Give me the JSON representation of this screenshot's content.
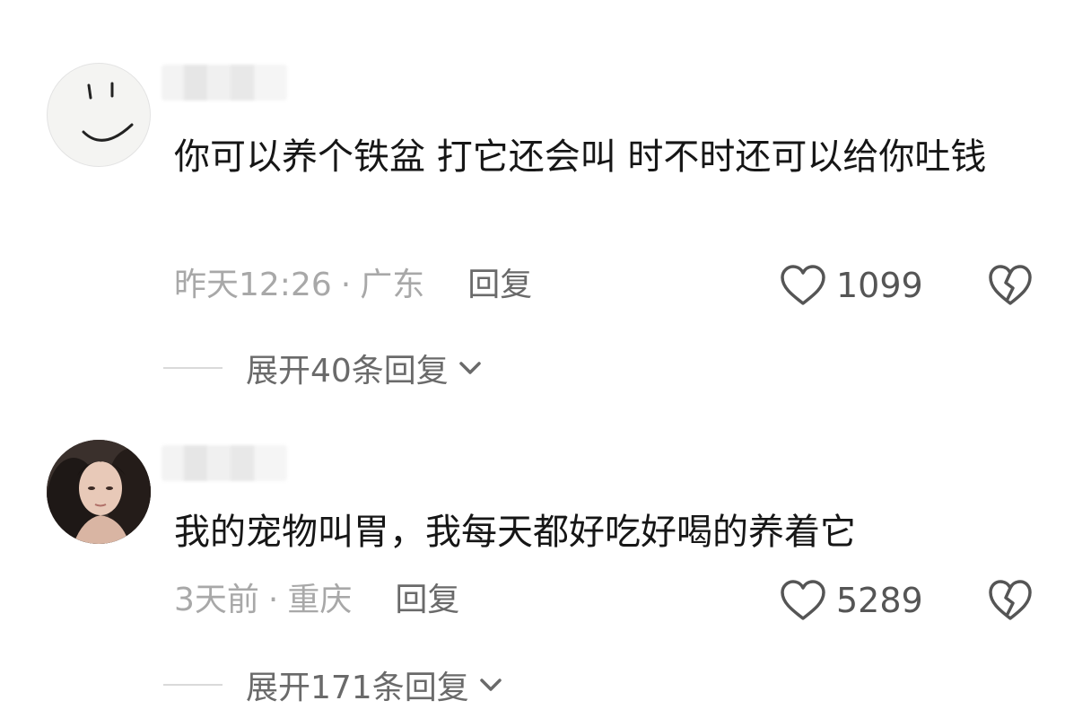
{
  "comments": [
    {
      "text": "你可以养个铁盆 打它还会叫 时不时还可以给你吐钱",
      "time": "昨天12:26",
      "location": "广东",
      "separator": "·",
      "reply_label": "回复",
      "like_count": "1099",
      "expand_label": "展开40条回复"
    },
    {
      "text": "我的宠物叫胃，我每天都好吃好喝的养着它",
      "time": "3天前",
      "location": "重庆",
      "separator": "·",
      "reply_label": "回复",
      "like_count": "5289",
      "expand_label": "展开171条回复"
    }
  ],
  "icons": {
    "like": "heart-outline-icon",
    "dislike": "broken-heart-icon",
    "expand": "chevron-down-icon"
  },
  "colors": {
    "text": "#161616",
    "meta": "#a8a8a8",
    "action": "#6a6a6a"
  }
}
